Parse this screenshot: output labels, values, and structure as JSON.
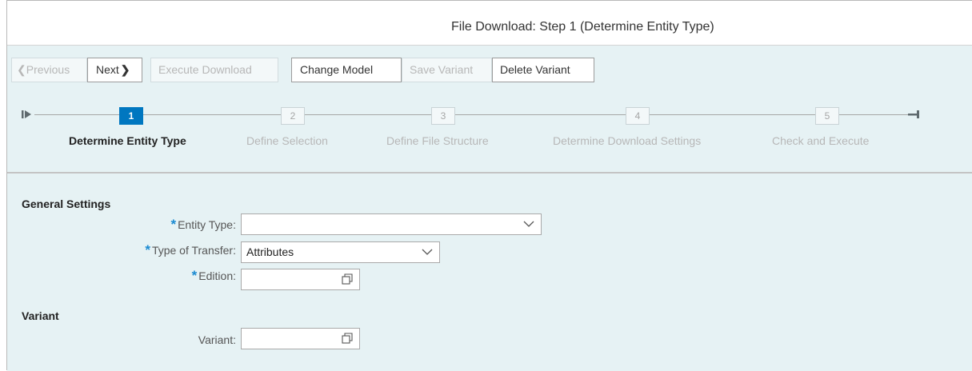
{
  "window": {
    "title": "File Download: Step 1  (Determine Entity Type)"
  },
  "toolbar": {
    "previous_label": "Previous",
    "next_label": "Next",
    "execute_label": "Execute Download",
    "change_model_label": "Change Model",
    "save_variant_label": "Save Variant",
    "delete_variant_label": "Delete Variant"
  },
  "roadmap": {
    "steps": [
      {
        "number": "1",
        "label": "Determine Entity Type",
        "active": true
      },
      {
        "number": "2",
        "label": "Define Selection",
        "active": false
      },
      {
        "number": "3",
        "label": "Define File Structure",
        "active": false
      },
      {
        "number": "4",
        "label": "Determine Download Settings",
        "active": false
      },
      {
        "number": "5",
        "label": "Check and Execute",
        "active": false
      }
    ]
  },
  "general_settings": {
    "heading": "General Settings",
    "entity_type": {
      "label": "Entity Type:",
      "value": ""
    },
    "type_of_transfer": {
      "label": "Type of Transfer:",
      "value": "Attributes"
    },
    "edition": {
      "label": "Edition:",
      "value": ""
    }
  },
  "variant_section": {
    "heading": "Variant",
    "variant": {
      "label": "Variant:",
      "value": ""
    }
  },
  "icons": {
    "previous": "chevron-left-icon",
    "next": "chevron-right-icon",
    "roadmap_start": "roadmap-start-icon",
    "roadmap_end": "roadmap-end-icon",
    "dropdown": "chevron-down-icon",
    "value_help": "value-help-icon"
  },
  "colors": {
    "accent": "#0077c0",
    "required": "#1a8ad1",
    "background": "#e6f2f4"
  }
}
